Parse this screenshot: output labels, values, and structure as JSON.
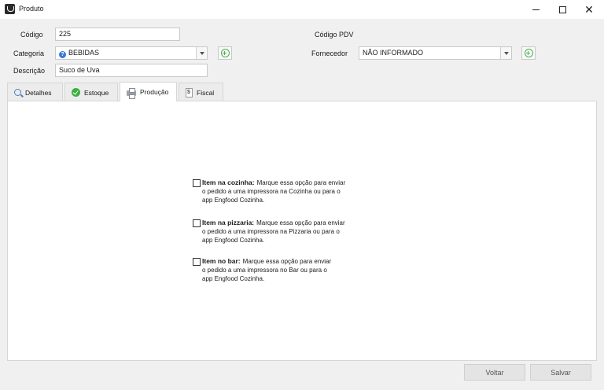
{
  "window": {
    "title": "Produto",
    "icon": "app-logo-icon",
    "minimize_icon": "minimize-icon",
    "maximize_icon": "maximize-icon",
    "close_glyph": "✕"
  },
  "form": {
    "codigo": {
      "label": "Código",
      "value": "225"
    },
    "codigo_pdv": {
      "label": "Código PDV",
      "value": ""
    },
    "categoria": {
      "label": "Categoria",
      "value": "BEBIDAS",
      "icon": "question-icon"
    },
    "fornecedor": {
      "label": "Fornecedor",
      "value": "NÃO INFORMADO"
    },
    "descricao": {
      "label": "Descrição",
      "value": "Suco de Uva"
    }
  },
  "tabs": [
    {
      "label": "Detalhes",
      "icon": "search-icon"
    },
    {
      "label": "Estoque",
      "icon": "check-circle-icon"
    },
    {
      "label": "Produção",
      "icon": "printer-icon",
      "active": true
    },
    {
      "label": "Fiscal",
      "icon": "tax-document-icon"
    }
  ],
  "producao": {
    "options": [
      {
        "title": "Item na cozinha:",
        "desc_line1": "Marque essa opção para enviar",
        "desc_line2": "o pedido a uma impressora na Cozinha ou para o",
        "desc_line3": "app Engfood Cozinha.",
        "checked": false
      },
      {
        "title": "Item na pizzaria:",
        "desc_line1": "Marque essa opção para enviar",
        "desc_line2": "o pedido a uma impressora na Pizzaria ou para o",
        "desc_line3": "app Engfood Cozinha.",
        "checked": false
      },
      {
        "title": "Item no bar:",
        "desc_line1": "Marque essa opção para enviar",
        "desc_line2": "o pedido a uma impressora no Bar ou para o",
        "desc_line3": "app Engfood Cozinha.",
        "checked": false
      }
    ]
  },
  "footer": {
    "voltar_label": "Voltar",
    "salvar_label": "Salvar"
  },
  "colors": {
    "accent_green": "#4caf50",
    "info_blue": "#3b78d8"
  }
}
